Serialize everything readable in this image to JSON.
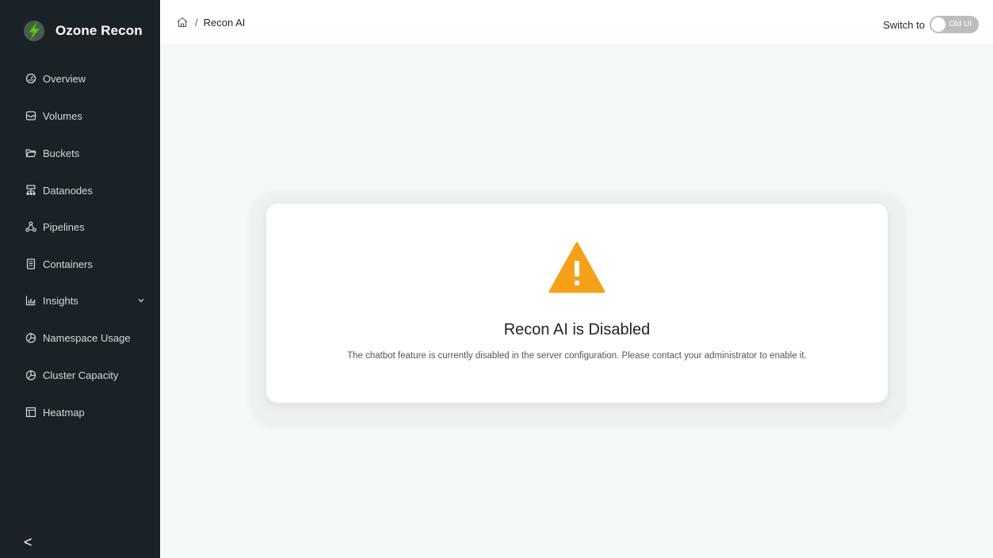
{
  "brand": {
    "name": "Ozone Recon",
    "logo_icon": "lightning-icon",
    "accent": "#56c41a"
  },
  "sidebar": {
    "items": [
      {
        "label": "Overview",
        "icon": "dashboard-icon"
      },
      {
        "label": "Volumes",
        "icon": "inbox-icon"
      },
      {
        "label": "Buckets",
        "icon": "folder-open-icon"
      },
      {
        "label": "Datanodes",
        "icon": "cluster-icon"
      },
      {
        "label": "Pipelines",
        "icon": "deployment-unit-icon"
      },
      {
        "label": "Containers",
        "icon": "container-icon"
      },
      {
        "label": "Insights",
        "icon": "bar-chart-icon"
      },
      {
        "label": "Namespace Usage",
        "icon": "pie-chart-icon"
      },
      {
        "label": "Cluster Capacity",
        "icon": "pie-chart-icon"
      },
      {
        "label": "Heatmap",
        "icon": "layout-icon"
      }
    ],
    "collapse_glyph": "<"
  },
  "header": {
    "breadcrumb": {
      "separator": "/",
      "current": "Recon AI"
    },
    "switch_label": "Switch to",
    "toggle_text": "Old UI"
  },
  "main": {
    "title": "Recon AI is Disabled",
    "description": "The chatbot feature is currently disabled in the server configuration. Please contact your administrator to enable it.",
    "warning_color": "#f5a018"
  }
}
